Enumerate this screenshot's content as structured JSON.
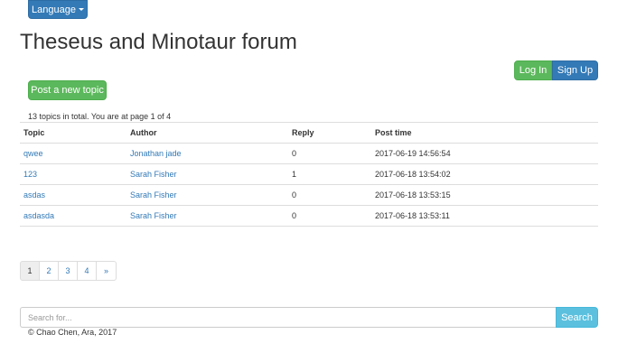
{
  "nav": {
    "language_label": "Language"
  },
  "header": {
    "title": "Theseus and Minotaur forum"
  },
  "auth": {
    "login_label": "Log In",
    "signup_label": "Sign Up"
  },
  "actions": {
    "post_label": "Post a new topic"
  },
  "summary": "13 topics in total. You are at page 1 of 4",
  "table": {
    "headers": {
      "topic": "Topic",
      "author": "Author",
      "reply": "Reply",
      "post_time": "Post time"
    },
    "rows": [
      {
        "topic": "qwee",
        "author": "Jonathan jade",
        "reply": "0",
        "post_time": "2017-06-19 14:56:54"
      },
      {
        "topic": "123",
        "author": "Sarah Fisher",
        "reply": "1",
        "post_time": "2017-06-18 13:54:02"
      },
      {
        "topic": "asdas",
        "author": "Sarah Fisher",
        "reply": "0",
        "post_time": "2017-06-18 13:53:15"
      },
      {
        "topic": "asdasda",
        "author": "Sarah Fisher",
        "reply": "0",
        "post_time": "2017-06-18 13:53:11"
      }
    ]
  },
  "pagination": {
    "pages": [
      "1",
      "2",
      "3",
      "4"
    ],
    "active": "1",
    "next": "»"
  },
  "search": {
    "placeholder": "Search for...",
    "button_label": "Search"
  },
  "footer": {
    "text": "© Chao Chen, Ara, 2017"
  },
  "colors": {
    "primary": "#337ab7",
    "success": "#5cb85c",
    "info": "#5bc0de"
  }
}
